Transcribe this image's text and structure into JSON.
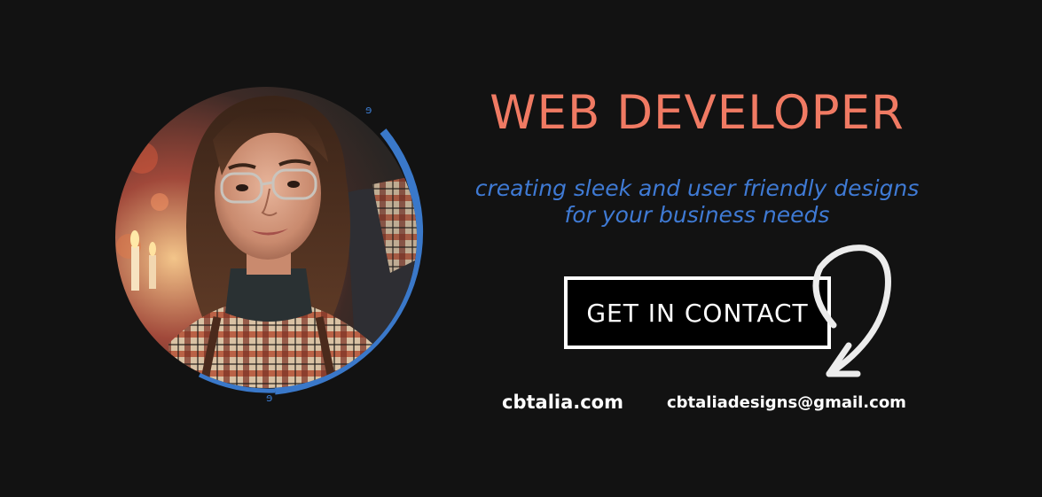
{
  "hero": {
    "title": "WEB DEVELOPER",
    "tagline_line1": "creating sleek and user friendly designs",
    "tagline_line2": "for your business needs"
  },
  "cta": {
    "label": "GET IN CONTACT"
  },
  "contact": {
    "website": "cbtalia.com",
    "email": "cbtaliadesigns@gmail.com"
  },
  "colors": {
    "background": "#121212",
    "title": "#f07a63",
    "tagline": "#3f7ad4",
    "accent_ring": "#3a78c9",
    "text": "#ffffff"
  },
  "icons": {
    "portrait": "portrait-illustration",
    "arrow": "curved-arrow-icon"
  }
}
